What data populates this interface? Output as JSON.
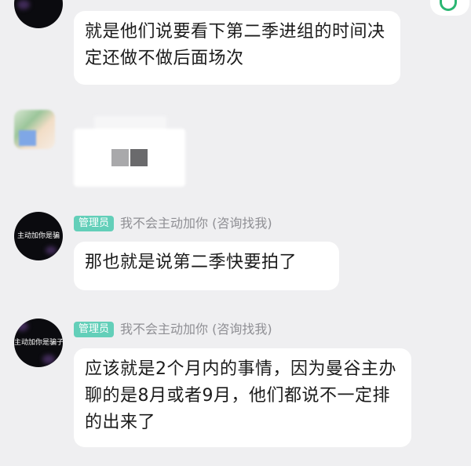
{
  "messages": [
    {
      "text": "就是他们说要看下第二季进组的时间决定还做不做后面场次"
    },
    {
      "role": "管理员",
      "sender": "我不会主动加你 (咨询找我)",
      "avatar_text": "主动加你是骗",
      "text": "那也就是说第二季快要拍了"
    },
    {
      "role": "管理员",
      "sender": "我不会主动加你 (咨询找我)",
      "avatar_text": "主动加你是骗子",
      "text": "应该就是2个月内的事情，因为曼谷主办聊的是8月或者9月，他们都说不一定排的出来了"
    }
  ],
  "colors": {
    "background": "#efeff1",
    "bubble": "#ffffff",
    "role_badge": "#63cfb9",
    "sender_name": "#8f8f94",
    "logo_green": "#2bb673"
  },
  "icons": {
    "top_right_logo": "app-logo-icon"
  }
}
